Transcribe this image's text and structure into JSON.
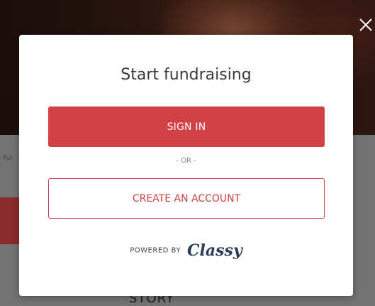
{
  "background": {
    "fund_text": "Fur",
    "story_heading": "STORY"
  },
  "modal": {
    "close_icon": "close-icon",
    "title": "Start fundraising",
    "sign_in_label": "SIGN IN",
    "divider_text": "- OR -",
    "create_account_label": "CREATE AN ACCOUNT",
    "powered_by_label": "POWERED BY",
    "brand_logo_text": "Classy"
  },
  "colors": {
    "accent": "#d04245",
    "brand_navy": "#2c3e55"
  }
}
